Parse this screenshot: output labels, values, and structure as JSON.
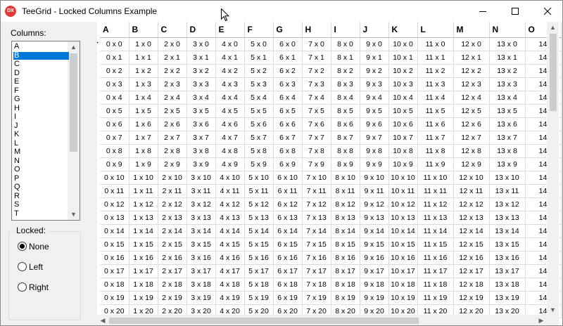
{
  "window": {
    "title": "TeeGrid - Locked Columns Example",
    "app_icon_text": "DX",
    "icons": [
      "minimize-icon",
      "maximize-icon",
      "close-icon"
    ]
  },
  "columns_panel": {
    "label": "Columns:",
    "items": [
      "A",
      "B",
      "C",
      "D",
      "E",
      "F",
      "G",
      "H",
      "I",
      "J",
      "K",
      "L",
      "M",
      "N",
      "O",
      "P",
      "Q",
      "R",
      "S",
      "T"
    ],
    "selected": "B"
  },
  "locked_group": {
    "title": "Locked:",
    "options": [
      "None",
      "Left",
      "Right"
    ],
    "selected": "None"
  },
  "grid": {
    "headers": [
      "A",
      "B",
      "C",
      "D",
      "E",
      "F",
      "G",
      "H",
      "I",
      "J",
      "K",
      "L",
      "M",
      "N",
      "O"
    ],
    "rows": [
      [
        "0 x 0",
        "1 x 0",
        "2 x 0",
        "3 x 0",
        "4 x 0",
        "5 x 0",
        "6 x 0",
        "7 x 0",
        "8 x 0",
        "9 x 0",
        "10 x 0",
        "11 x 0",
        "12 x 0",
        "13 x 0",
        "14"
      ],
      [
        "0 x 1",
        "1 x 1",
        "2 x 1",
        "3 x 1",
        "4 x 1",
        "5 x 1",
        "6 x 1",
        "7 x 1",
        "8 x 1",
        "9 x 1",
        "10 x 1",
        "11 x 1",
        "12 x 1",
        "13 x 1",
        "14"
      ],
      [
        "0 x 2",
        "1 x 2",
        "2 x 2",
        "3 x 2",
        "4 x 2",
        "5 x 2",
        "6 x 2",
        "7 x 2",
        "8 x 2",
        "9 x 2",
        "10 x 2",
        "11 x 2",
        "12 x 2",
        "13 x 2",
        "14"
      ],
      [
        "0 x 3",
        "1 x 3",
        "2 x 3",
        "3 x 3",
        "4 x 3",
        "5 x 3",
        "6 x 3",
        "7 x 3",
        "8 x 3",
        "9 x 3",
        "10 x 3",
        "11 x 3",
        "12 x 3",
        "13 x 3",
        "14"
      ],
      [
        "0 x 4",
        "1 x 4",
        "2 x 4",
        "3 x 4",
        "4 x 4",
        "5 x 4",
        "6 x 4",
        "7 x 4",
        "8 x 4",
        "9 x 4",
        "10 x 4",
        "11 x 4",
        "12 x 4",
        "13 x 4",
        "14"
      ],
      [
        "0 x 5",
        "1 x 5",
        "2 x 5",
        "3 x 5",
        "4 x 5",
        "5 x 5",
        "6 x 5",
        "7 x 5",
        "8 x 5",
        "9 x 5",
        "10 x 5",
        "11 x 5",
        "12 x 5",
        "13 x 5",
        "14"
      ],
      [
        "0 x 6",
        "1 x 6",
        "2 x 6",
        "3 x 6",
        "4 x 6",
        "5 x 6",
        "6 x 6",
        "7 x 6",
        "8 x 6",
        "9 x 6",
        "10 x 6",
        "11 x 6",
        "12 x 6",
        "13 x 6",
        "14"
      ],
      [
        "0 x 7",
        "1 x 7",
        "2 x 7",
        "3 x 7",
        "4 x 7",
        "5 x 7",
        "6 x 7",
        "7 x 7",
        "8 x 7",
        "9 x 7",
        "10 x 7",
        "11 x 7",
        "12 x 7",
        "13 x 7",
        "14"
      ],
      [
        "0 x 8",
        "1 x 8",
        "2 x 8",
        "3 x 8",
        "4 x 8",
        "5 x 8",
        "6 x 8",
        "7 x 8",
        "8 x 8",
        "9 x 8",
        "10 x 8",
        "11 x 8",
        "12 x 8",
        "13 x 8",
        "14"
      ],
      [
        "0 x 9",
        "1 x 9",
        "2 x 9",
        "3 x 9",
        "4 x 9",
        "5 x 9",
        "6 x 9",
        "7 x 9",
        "8 x 9",
        "9 x 9",
        "10 x 9",
        "11 x 9",
        "12 x 9",
        "13 x 9",
        "14"
      ],
      [
        "0 x 10",
        "1 x 10",
        "2 x 10",
        "3 x 10",
        "4 x 10",
        "5 x 10",
        "6 x 10",
        "7 x 10",
        "8 x 10",
        "9 x 10",
        "10 x 10",
        "11 x 10",
        "12 x 10",
        "13 x 10",
        "14"
      ],
      [
        "0 x 11",
        "1 x 11",
        "2 x 11",
        "3 x 11",
        "4 x 11",
        "5 x 11",
        "6 x 11",
        "7 x 11",
        "8 x 11",
        "9 x 11",
        "10 x 11",
        "11 x 11",
        "12 x 11",
        "13 x 11",
        "14"
      ],
      [
        "0 x 12",
        "1 x 12",
        "2 x 12",
        "3 x 12",
        "4 x 12",
        "5 x 12",
        "6 x 12",
        "7 x 12",
        "8 x 12",
        "9 x 12",
        "10 x 12",
        "11 x 12",
        "12 x 12",
        "13 x 12",
        "14"
      ],
      [
        "0 x 13",
        "1 x 13",
        "2 x 13",
        "3 x 13",
        "4 x 13",
        "5 x 13",
        "6 x 13",
        "7 x 13",
        "8 x 13",
        "9 x 13",
        "10 x 13",
        "11 x 13",
        "12 x 13",
        "13 x 13",
        "14"
      ],
      [
        "0 x 14",
        "1 x 14",
        "2 x 14",
        "3 x 14",
        "4 x 14",
        "5 x 14",
        "6 x 14",
        "7 x 14",
        "8 x 14",
        "9 x 14",
        "10 x 14",
        "11 x 14",
        "12 x 14",
        "13 x 14",
        "14"
      ],
      [
        "0 x 15",
        "1 x 15",
        "2 x 15",
        "3 x 15",
        "4 x 15",
        "5 x 15",
        "6 x 15",
        "7 x 15",
        "8 x 15",
        "9 x 15",
        "10 x 15",
        "11 x 15",
        "12 x 15",
        "13 x 15",
        "14"
      ],
      [
        "0 x 16",
        "1 x 16",
        "2 x 16",
        "3 x 16",
        "4 x 16",
        "5 x 16",
        "6 x 16",
        "7 x 16",
        "8 x 16",
        "9 x 16",
        "10 x 16",
        "11 x 16",
        "12 x 16",
        "13 x 16",
        "14"
      ],
      [
        "0 x 17",
        "1 x 17",
        "2 x 17",
        "3 x 17",
        "4 x 17",
        "5 x 17",
        "6 x 17",
        "7 x 17",
        "8 x 17",
        "9 x 17",
        "10 x 17",
        "11 x 17",
        "12 x 17",
        "13 x 17",
        "14"
      ],
      [
        "0 x 18",
        "1 x 18",
        "2 x 18",
        "3 x 18",
        "4 x 18",
        "5 x 18",
        "6 x 18",
        "7 x 18",
        "8 x 18",
        "9 x 18",
        "10 x 18",
        "11 x 18",
        "12 x 18",
        "13 x 18",
        "14"
      ],
      [
        "0 x 19",
        "1 x 19",
        "2 x 19",
        "3 x 19",
        "4 x 19",
        "5 x 19",
        "6 x 19",
        "7 x 19",
        "8 x 19",
        "9 x 19",
        "10 x 19",
        "11 x 19",
        "12 x 19",
        "13 x 19",
        "14"
      ],
      [
        "0 x 20",
        "1 x 20",
        "2 x 20",
        "3 x 20",
        "4 x 20",
        "5 x 20",
        "6 x 20",
        "7 x 20",
        "8 x 20",
        "9 x 20",
        "10 x 20",
        "11 x 20",
        "12 x 20",
        "13 x 20",
        "14"
      ]
    ],
    "current_row_indicator": "▶"
  },
  "colors": {
    "selection": "#0078d7",
    "app_icon": "#e13c3c"
  }
}
